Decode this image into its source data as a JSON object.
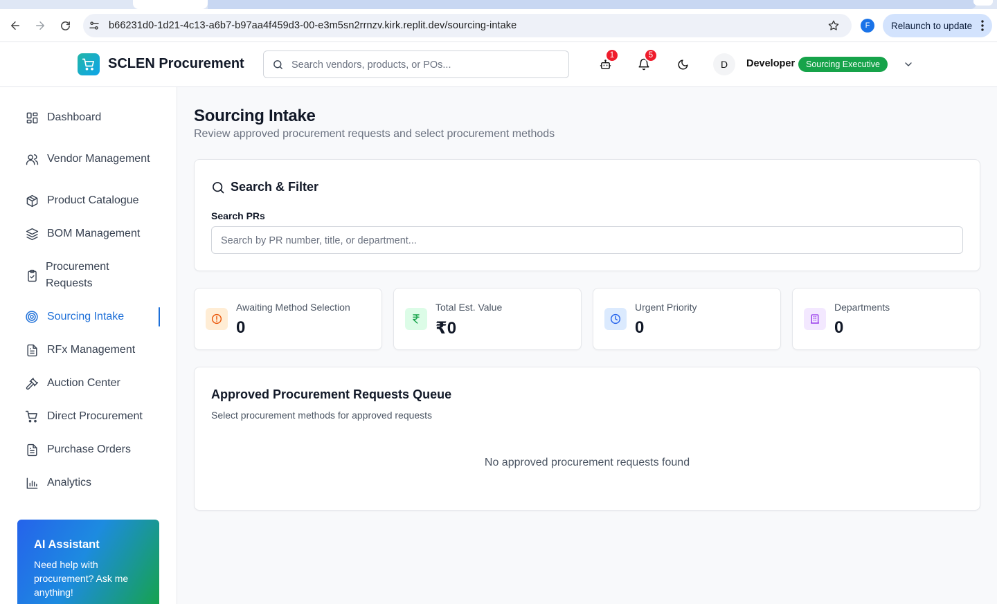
{
  "browser": {
    "url": "b66231d0-1d21-4c13-a6b7-b97aa4f459d3-00-e3m5sn2rrnzv.kirk.replit.dev/sourcing-intake",
    "profile_initial": "F",
    "relaunch_label": "Relaunch to update"
  },
  "header": {
    "brand": "SCLEN Procurement",
    "search_placeholder": "Search vendors, products, or POs...",
    "bot_badge": "1",
    "notifications_badge": "5",
    "avatar_initial": "D",
    "username": "Developer",
    "role": "Sourcing Executive"
  },
  "sidebar": {
    "items": [
      {
        "label": "Dashboard",
        "icon": "grid-icon"
      },
      {
        "label": "Vendor Management",
        "icon": "users-icon"
      },
      {
        "label": "Product Catalogue",
        "icon": "package-icon"
      },
      {
        "label": "BOM Management",
        "icon": "layers-icon"
      },
      {
        "label": "Procurement Requests",
        "icon": "clipboard-check-icon"
      },
      {
        "label": "Sourcing Intake",
        "icon": "target-icon",
        "active": true
      },
      {
        "label": "RFx Management",
        "icon": "file-text-icon"
      },
      {
        "label": "Auction Center",
        "icon": "gavel-icon"
      },
      {
        "label": "Direct Procurement",
        "icon": "cart-icon"
      },
      {
        "label": "Purchase Orders",
        "icon": "file-text-icon"
      },
      {
        "label": "Analytics",
        "icon": "bar-chart-icon"
      }
    ],
    "ai": {
      "title": "AI Assistant",
      "description": "Need help with procurement? Ask me anything!"
    }
  },
  "main": {
    "title": "Sourcing Intake",
    "subtitle": "Review approved procurement requests and select procurement methods",
    "filter": {
      "heading": "Search & Filter",
      "label": "Search PRs",
      "placeholder": "Search by PR number, title, or department..."
    },
    "stats": [
      {
        "label": "Awaiting Method Selection",
        "value": "0",
        "icon": "alert-circle-icon",
        "color": "#ea580c",
        "bg": "#ffedd5"
      },
      {
        "label": "Total Est. Value",
        "value": "₹0",
        "icon": "rupee-icon",
        "color": "#16a34a",
        "bg": "#dcfce7"
      },
      {
        "label": "Urgent Priority",
        "value": "0",
        "icon": "clock-icon",
        "color": "#2563eb",
        "bg": "#dbeafe"
      },
      {
        "label": "Departments",
        "value": "0",
        "icon": "building-icon",
        "color": "#9333ea",
        "bg": "#f3e8ff"
      }
    ],
    "queue": {
      "title": "Approved Procurement Requests Queue",
      "subtitle": "Select procurement methods for approved requests",
      "empty": "No approved procurement requests found"
    }
  }
}
